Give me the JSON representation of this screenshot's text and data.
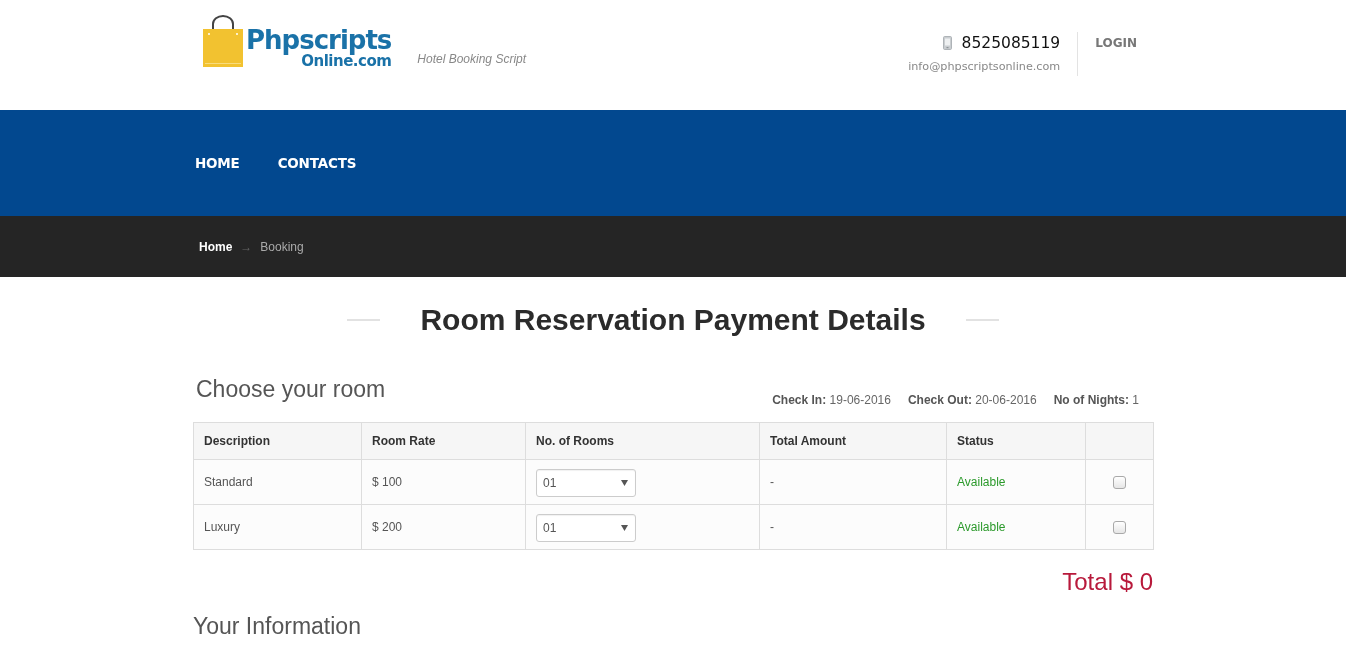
{
  "header": {
    "logo": {
      "title": "Phpscripts",
      "subtitle": "Online.com"
    },
    "tagline": "Hotel Booking Script",
    "phone": "8525085119",
    "email": "info@phpscriptsonline.com",
    "login": "LOGIN"
  },
  "nav": {
    "items": [
      {
        "label": "HOME"
      },
      {
        "label": "CONTACTS"
      }
    ]
  },
  "breadcrumb": {
    "items": [
      {
        "label": "Home",
        "current": false
      },
      {
        "label": "Booking",
        "current": true
      }
    ],
    "separator": "→"
  },
  "page_title": "Room Reservation Payment Details",
  "room_section": {
    "heading": "Choose your room",
    "stay_info": [
      "**Check In:** 19-06-2016",
      "**Check Out:** 20-06-2016",
      "**No of Nights:** 1"
    ],
    "table": {
      "columns": [
        "Description",
        "Room Rate",
        "No. of Rooms",
        "Total Amount",
        "Status"
      ],
      "rows": [
        {
          "description": "Standard",
          "room_rate": "$ 100",
          "rooms": "01",
          "total_amount": "-",
          "status": "Available",
          "checked": false
        },
        {
          "description": "Luxury",
          "room_rate": "$ 200",
          "rooms": "01",
          "total_amount": "-",
          "status": "Available",
          "checked": false
        }
      ]
    },
    "total": "Total $ 0"
  },
  "info_section": {
    "heading": "Your Information"
  }
}
